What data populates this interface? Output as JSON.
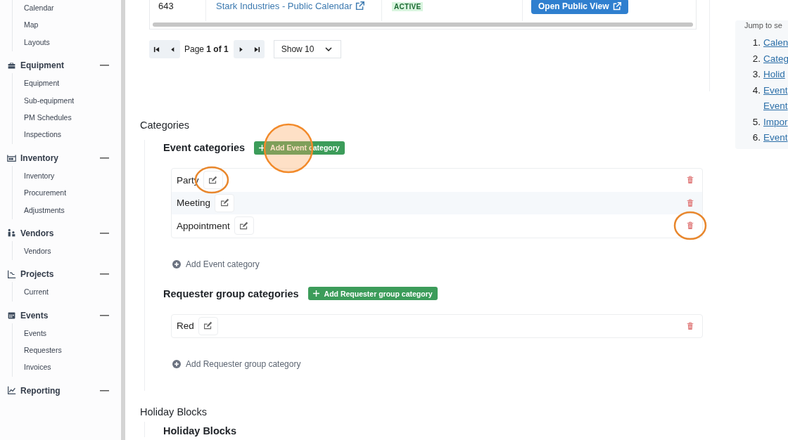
{
  "sidebar": {
    "groups": [
      {
        "items": [
          "Calendar",
          "Map",
          "Layouts"
        ]
      },
      {
        "title": "Equipment",
        "expanded": true,
        "items": [
          "Equipment",
          "Sub-equipment",
          "PM Schedules",
          "Inspections"
        ]
      },
      {
        "title": "Inventory",
        "expanded": true,
        "items": [
          "Inventory",
          "Procurement",
          "Adjustments"
        ]
      },
      {
        "title": "Vendors",
        "expanded": true,
        "items": [
          "Vendors"
        ]
      },
      {
        "title": "Projects",
        "expanded": true,
        "items": [
          "Current"
        ]
      },
      {
        "title": "Events",
        "expanded": true,
        "items": [
          "Events",
          "Requesters",
          "Invoices"
        ]
      },
      {
        "title": "Reporting",
        "expanded": true
      }
    ]
  },
  "table": {
    "rows": [
      {
        "id": "643",
        "name": "Stark Industries - Public Calendar",
        "status": "ACTIVE",
        "action": "Open Public View"
      }
    ]
  },
  "pagination": {
    "page": "Page **1 of 1**",
    "show": "Show 10"
  },
  "categories": {
    "title": "Categories",
    "groups": [
      {
        "title": "Event categories",
        "add_button": "Add Event category",
        "highlighted": true,
        "items": [
          {
            "label": "Party",
            "edit_circled": true,
            "delete_circled": false
          },
          {
            "label": "Meeting",
            "edit_circled": false,
            "delete_circled": false
          },
          {
            "label": "Appointment",
            "edit_circled": false,
            "delete_circled": true
          }
        ],
        "add_link": "Add Event category"
      },
      {
        "title": "Requester group categories",
        "add_button": "Add Requester group category",
        "highlighted": false,
        "items": [
          {
            "label": "Red",
            "edit_circled": false,
            "delete_circled": false
          }
        ],
        "add_link": "Add Requester group category"
      }
    ]
  },
  "holiday": {
    "title": "Holiday Blocks",
    "subtitle": "Holiday Blocks"
  },
  "toc": {
    "title": "Jump to se",
    "items": [
      {
        "number": "1.",
        "lines": [
          "Calen"
        ]
      },
      {
        "number": "2.",
        "lines": [
          "Categ"
        ]
      },
      {
        "number": "3.",
        "lines": [
          "Holid"
        ]
      },
      {
        "number": "4.",
        "lines": [
          "Event",
          "Event"
        ]
      },
      {
        "number": "5.",
        "lines": [
          "Impor"
        ]
      },
      {
        "number": "6.",
        "lines": [
          "Event"
        ]
      }
    ]
  }
}
